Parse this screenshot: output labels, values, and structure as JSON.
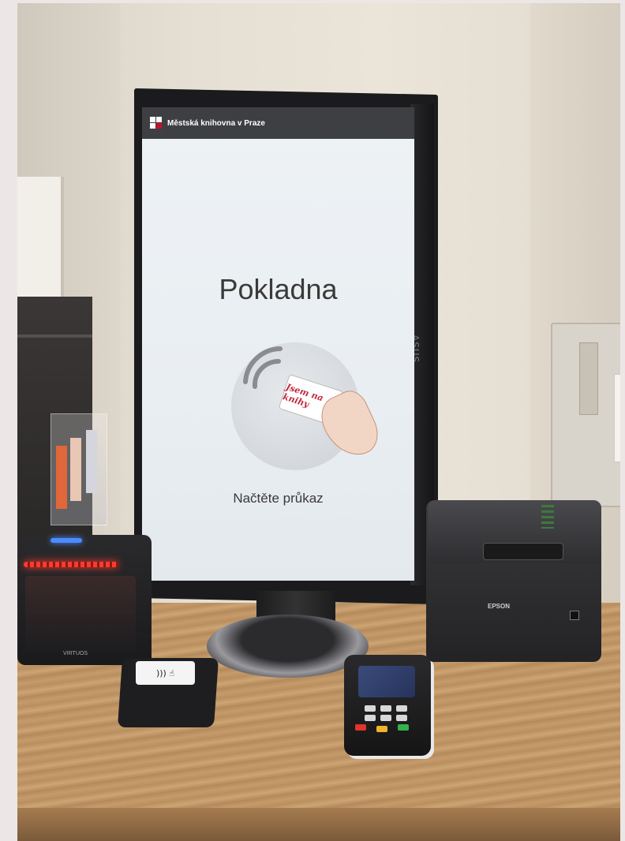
{
  "screen": {
    "brand": "Městská knihovna v Praze",
    "title": "Pokladna",
    "instruction": "Načtěte průkaz",
    "card_text": "Jsem na knihy"
  },
  "devices": {
    "monitor_logo": "ASUS",
    "printer_brand": "EPSON",
    "scanner_brand": "VIRTUOS",
    "nfc_label": "))) ☝"
  },
  "icons": [
    "library-logo-icon",
    "contactless-card-icon",
    "nfc-symbol-icon"
  ],
  "colors": {
    "header_bg": "#3d3f42",
    "logo_red": "#c8102e",
    "card_red": "#c2273d",
    "scanner_led": "#ff3a2e"
  }
}
